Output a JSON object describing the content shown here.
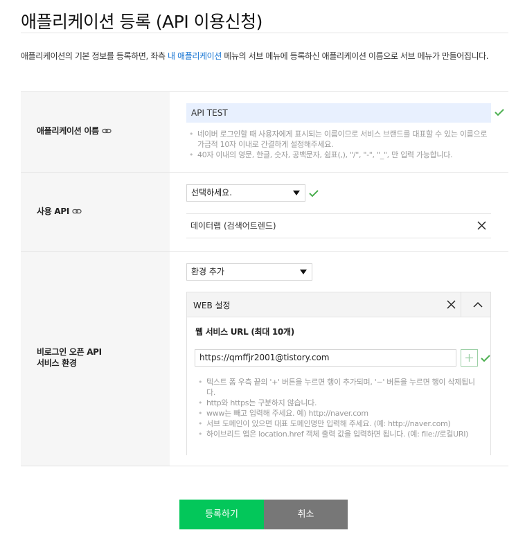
{
  "page": {
    "title": "애플리케이션 등록 (API 이용신청)",
    "description_before": "애플리케이션의 기본 정보를 등록하면, 좌측 ",
    "description_link": "내 애플리케이션",
    "description_after": " 메뉴의 서브 메뉴에 등록하신 애플리케이션 이름으로 서브 메뉴가 만들어집니다."
  },
  "app_name": {
    "label": "애플리케이션 이름",
    "value": "API TEST",
    "hints": [
      "네이버 로그인할 때 사용자에게 표시되는 이름이므로 서비스 브랜드를 대표할 수 있는 이름으로 가급적 10자 이내로 간결하게 설정해주세요.",
      "40자 이내의 영문, 한글, 숫자, 공백문자, 쉼표(,), \"/\", \"-\", \"_\", 만 입력 가능합니다."
    ]
  },
  "api": {
    "label": "사용 API",
    "select_value": "선택하세요.",
    "selected_item": "데이터랩 (검색어트렌드)"
  },
  "env": {
    "label_line1": "비로그인 오픈 API",
    "label_line2": "서비스 환경",
    "select_value": "환경 추가",
    "panel_title": "WEB 설정",
    "url_label": "웹 서비스 URL (최대 10개)",
    "url_value": "https://qmffjr2001@tistory.com",
    "hints": [
      "텍스트 폼 우측 끝의 '+' 버튼을 누르면 행이 추가되며, '−' 버튼을 누르면 행이 삭제됩니다.",
      "http와 https는 구분하지 않습니다.",
      "www는 빼고 입력해 주세요. 예) http://naver.com",
      "서브 도메인이 있으면 대표 도메인명만 입력해 주세요. (예: http://naver.com)",
      "하이브리드 앱은 location.href 객체 출력 값을 입력하면 됩니다. (예: file://로컬URI)"
    ]
  },
  "buttons": {
    "submit": "등록하기",
    "cancel": "취소"
  },
  "colors": {
    "accent": "#03c75a",
    "check": "#4caf50",
    "link": "#0d6fd1",
    "cancel_bg": "#777777",
    "input_highlight": "#e8f0fe"
  },
  "icons": {
    "link": "link-icon",
    "check": "check-icon",
    "close": "close-icon",
    "collapse": "chevron-up-icon",
    "plus": "plus-icon",
    "dropdown": "caret-down-icon"
  }
}
